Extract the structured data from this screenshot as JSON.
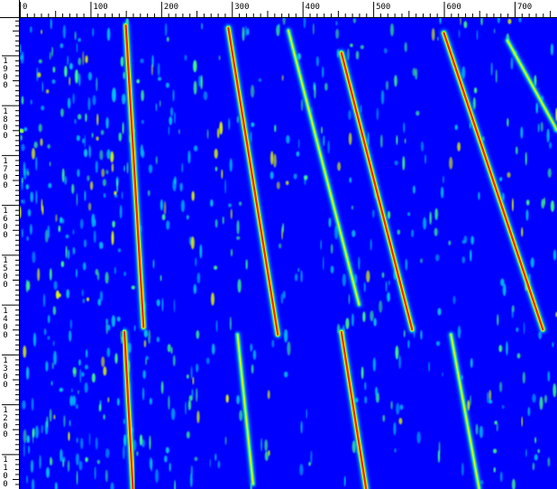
{
  "colors": {
    "background": "#0000ff",
    "noise_low": "#00c8ff",
    "noise_mid": "#40ff80",
    "line_mid": "#e0ff00",
    "line_peak": "#ff2000"
  },
  "x_axis": {
    "tick_labels": [
      "0",
      "100",
      "200",
      "300",
      "400",
      "500",
      "600",
      "700"
    ],
    "values": [
      0,
      100,
      200,
      300,
      400,
      500,
      600,
      700
    ]
  },
  "y_axis": {
    "tick_labels": [
      "1900",
      "1800",
      "1700",
      "1600",
      "1500",
      "1400",
      "1300",
      "1200",
      "1100"
    ],
    "values": [
      1900,
      1800,
      1700,
      1600,
      1500,
      1400,
      1300,
      1200,
      1100
    ]
  },
  "chart_data": {
    "type": "heatmap",
    "description_free": true,
    "xlim": [
      0,
      760
    ],
    "ylim": [
      1030,
      1975
    ],
    "traces": [
      {
        "x1": 150,
        "y1": 1960,
        "x2": 175,
        "y2": 1355,
        "level": "peak"
      },
      {
        "x1": 148,
        "y1": 1345,
        "x2": 160,
        "y2": 1030,
        "level": "peak"
      },
      {
        "x1": 295,
        "y1": 1955,
        "x2": 365,
        "y2": 1340,
        "level": "peak"
      },
      {
        "x1": 308,
        "y1": 1340,
        "x2": 330,
        "y2": 1040,
        "level": "mid"
      },
      {
        "x1": 380,
        "y1": 1950,
        "x2": 480,
        "y2": 1400,
        "level": "mid"
      },
      {
        "x1": 455,
        "y1": 1905,
        "x2": 555,
        "y2": 1350,
        "level": "peak"
      },
      {
        "x1": 455,
        "y1": 1345,
        "x2": 490,
        "y2": 1030,
        "level": "peak"
      },
      {
        "x1": 600,
        "y1": 1945,
        "x2": 740,
        "y2": 1350,
        "level": "peak"
      },
      {
        "x1": 610,
        "y1": 1340,
        "x2": 650,
        "y2": 1030,
        "level": "mid"
      },
      {
        "x1": 690,
        "y1": 1930,
        "x2": 760,
        "y2": 1750,
        "level": "mid"
      }
    ]
  }
}
